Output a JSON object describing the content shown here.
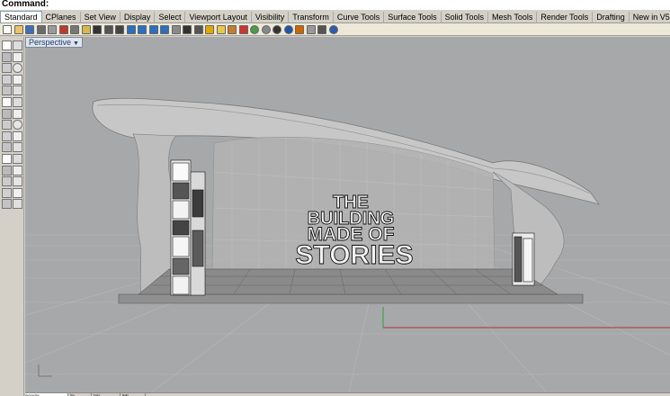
{
  "command": {
    "label": "Command:"
  },
  "tabs": [
    {
      "label": "Standard",
      "active": true
    },
    {
      "label": "CPlanes"
    },
    {
      "label": "Set View"
    },
    {
      "label": "Display"
    },
    {
      "label": "Select"
    },
    {
      "label": "Viewport Layout"
    },
    {
      "label": "Visibility"
    },
    {
      "label": "Transform"
    },
    {
      "label": "Curve Tools"
    },
    {
      "label": "Surface Tools"
    },
    {
      "label": "Solid Tools"
    },
    {
      "label": "Mesh Tools"
    },
    {
      "label": "Render Tools"
    },
    {
      "label": "Drafting"
    },
    {
      "label": "New in V5"
    }
  ],
  "toolbar_icons": [
    "new-icon",
    "open-icon",
    "save-icon",
    "print-icon",
    "import-icon",
    "cut-icon",
    "copy-icon",
    "paste-icon",
    "undo-icon",
    "pan-icon",
    "rotate-view-icon",
    "zoom-icon",
    "zoom-window-icon",
    "zoom-extents-icon",
    "zoom-selected-icon",
    "grid-icon",
    "select-icon",
    "point-icon",
    "layer-icon",
    "lightbulb-icon",
    "properties-icon",
    "material-icon",
    "render-sphere-icon",
    "shaded-sphere-icon",
    "ghosted-sphere-icon",
    "rendered-sphere-icon",
    "osnap-icon",
    "filter-icon",
    "curve-tools-icon",
    "help-icon"
  ],
  "sidebar_icons": [
    "select-arrow-icon",
    "point-icon",
    "polyline-icon",
    "line-icon",
    "arc-icon",
    "circle-icon",
    "curve-icon",
    "rectangle-icon",
    "ellipse-icon",
    "polygon-icon",
    "free-form-icon",
    "surface-icon",
    "extrude-icon",
    "box-icon",
    "solid-icon",
    "sphere-icon",
    "mesh-icon",
    "boolean-icon",
    "transform-icon",
    "move-icon",
    "array-icon",
    "fillet-icon",
    "trim-icon",
    "split-icon",
    "text-icon",
    "dimension-icon",
    "block-icon",
    "check-icon",
    "analyze-icon",
    "render-icon"
  ],
  "viewport": {
    "name": "Perspective",
    "sign_lines": [
      "THE",
      "BUILDING",
      "MADE OF",
      "STORIES"
    ]
  },
  "bottom_tabs": [
    "Perspective",
    "Top",
    "Front",
    "Right"
  ],
  "colors": {
    "viewport_bg": "#a6a8a9",
    "x_axis": "#b03030",
    "y_axis": "#2f9e3a",
    "active_tab": "#ffffff"
  }
}
